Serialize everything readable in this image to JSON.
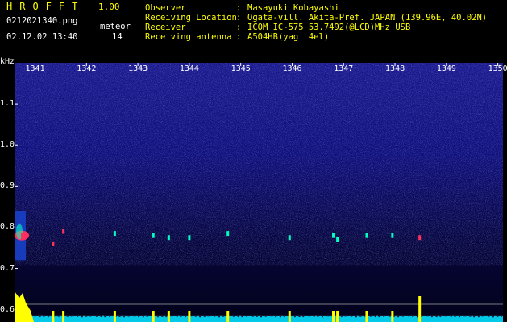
{
  "header": {
    "app_title": "HROFFT",
    "app_version": "1.00",
    "filename": "0212021340.png",
    "datetime": "02.12.02 13:40",
    "meteor_label": "meteor",
    "meteor_count": "14"
  },
  "info": [
    {
      "label": "Observer",
      "sep": ":",
      "value": "Masayuki Kobayashi"
    },
    {
      "label": "Receiving Location",
      "sep": ":",
      "value": "Ogata-vill. Akita-Pref. JAPAN (139.96E, 40.02N)"
    },
    {
      "label": "Receiver",
      "sep": ":",
      "value": "ICOM IC-575 53.7492(@LCD)MHz USB"
    },
    {
      "label": "Receiving antenna",
      "sep": ":",
      "value": "A504HB(yagi 4el)"
    }
  ],
  "chart_data": {
    "type": "heatmap",
    "y_unit_label": "kHz",
    "x_ticks": [
      "1341",
      "1342",
      "1343",
      "1344",
      "1345",
      "1346",
      "1347",
      "1348",
      "1349",
      "1350"
    ],
    "y_ticks": [
      "1.1",
      "1.0",
      "0.9",
      "0.8",
      "0.7",
      "0.6"
    ],
    "ylim": [
      0.57,
      1.2
    ],
    "xlim": [
      1340.6,
      1350.1
    ],
    "meteor_echoes": [
      {
        "t": 1340.75,
        "khz": 0.78
      },
      {
        "t": 1341.35,
        "khz": 0.76
      },
      {
        "t": 1341.55,
        "khz": 0.79
      },
      {
        "t": 1342.55,
        "khz": 0.785
      },
      {
        "t": 1343.3,
        "khz": 0.78
      },
      {
        "t": 1343.6,
        "khz": 0.775
      },
      {
        "t": 1344.0,
        "khz": 0.775
      },
      {
        "t": 1344.75,
        "khz": 0.785
      },
      {
        "t": 1345.95,
        "khz": 0.775
      },
      {
        "t": 1346.8,
        "khz": 0.78
      },
      {
        "t": 1346.88,
        "khz": 0.77
      },
      {
        "t": 1347.45,
        "khz": 0.78
      },
      {
        "t": 1347.95,
        "khz": 0.78
      },
      {
        "t": 1348.48,
        "khz": 0.775
      }
    ],
    "colors": {
      "background": "#0a0a4a",
      "noise": "#3a3ac8",
      "signal_strong": "#ff3060",
      "signal_mid": "#00ffc0",
      "trace_yellow": "#ffff00",
      "trace_cyan": "#00e0ff",
      "ref_line": "#c8c8c8"
    }
  }
}
